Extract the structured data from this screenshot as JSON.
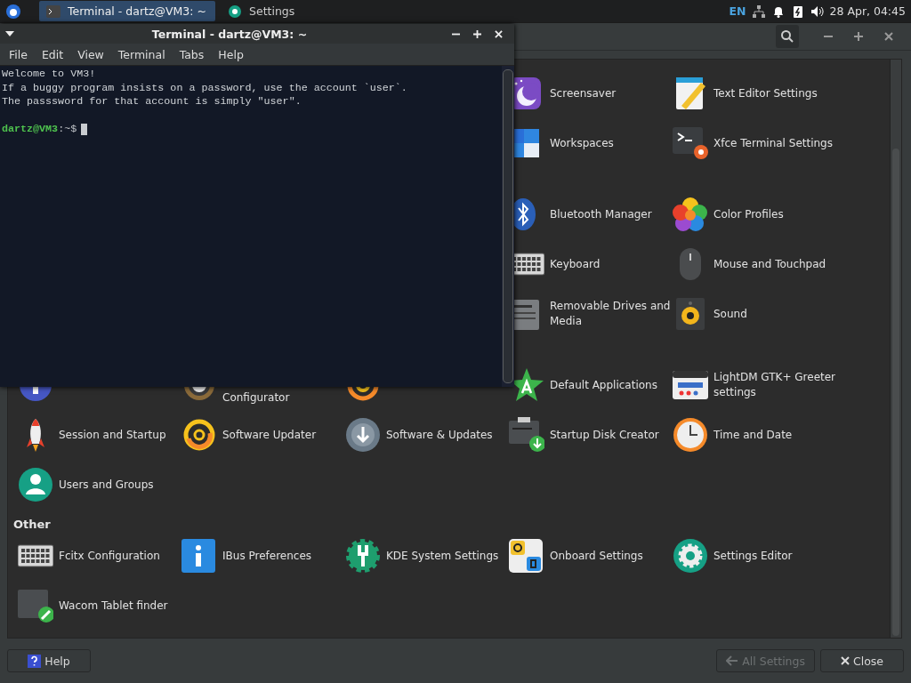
{
  "panel": {
    "tasks": [
      {
        "label": "Terminal - dartz@VM3: ~",
        "selected": true
      },
      {
        "label": "Settings",
        "selected": false
      }
    ],
    "keyboard_layout": "EN",
    "clock": "28 Apr, 04:45"
  },
  "terminal": {
    "title": "Terminal - dartz@VM3: ~",
    "menu": [
      "File",
      "Edit",
      "View",
      "Terminal",
      "Tabs",
      "Help"
    ],
    "lines": [
      "Welcome to VM3!",
      "If a buggy program insists on a password, use the account `user`.",
      "The passsword for that account is simply \"user\"."
    ],
    "prompt": {
      "user_host": "dartz@VM3",
      "path": ":~$"
    }
  },
  "settings": {
    "sections": [
      {
        "rows": [
          {
            "covered_by_terminal": true,
            "items": [
              {
                "label": "Screensaver"
              },
              {
                "label": "Text Editor Settings"
              }
            ]
          },
          {
            "covered_by_terminal": true,
            "items": [
              {
                "label": "Workspaces"
              },
              {
                "label": "Xfce Terminal Settings"
              }
            ]
          }
        ]
      },
      {
        "rows": [
          {
            "covered_by_terminal": true,
            "items": [
              {
                "label": "Bluetooth Manager"
              },
              {
                "label": "Color Profiles"
              }
            ]
          },
          {
            "covered_by_terminal": true,
            "items": [
              {
                "label": "Keyboard"
              },
              {
                "label": "Mouse and Touchpad"
              }
            ]
          },
          {
            "covered_by_terminal": true,
            "items": [
              {
                "label": "Removable Drives and Media"
              },
              {
                "label": "Sound"
              }
            ]
          }
        ]
      },
      {
        "rows": [
          {
            "items": [
              {
                "covered": true
              },
              {
                "label": "Configurator",
                "kind": "second_line"
              },
              {
                "covered": true
              },
              {
                "label": "Default Applications"
              },
              {
                "label": "LightDM GTK+ Greeter settings"
              }
            ]
          },
          {
            "items": [
              {
                "label": "Session and Startup"
              },
              {
                "label": "Software Updater"
              },
              {
                "label": "Software & Updates"
              },
              {
                "label": "Startup Disk Creator"
              },
              {
                "label": "Time and Date"
              }
            ]
          },
          {
            "items": [
              {
                "label": "Users and Groups"
              }
            ]
          }
        ]
      },
      {
        "title": "Other",
        "rows": [
          {
            "items": [
              {
                "label": "Fcitx Configuration"
              },
              {
                "label": "IBus Preferences"
              },
              {
                "label": "KDE System Settings"
              },
              {
                "label": "Onboard Settings"
              },
              {
                "label": "Settings Editor"
              }
            ]
          },
          {
            "items": [
              {
                "label": "Wacom Tablet finder"
              }
            ]
          }
        ]
      }
    ]
  },
  "buttons": [
    {
      "label": "Help",
      "kind": "help",
      "disabled": false
    },
    {
      "label": "All Settings",
      "kind": "back",
      "disabled": true
    },
    {
      "label": "Close",
      "kind": "close",
      "disabled": false
    }
  ]
}
